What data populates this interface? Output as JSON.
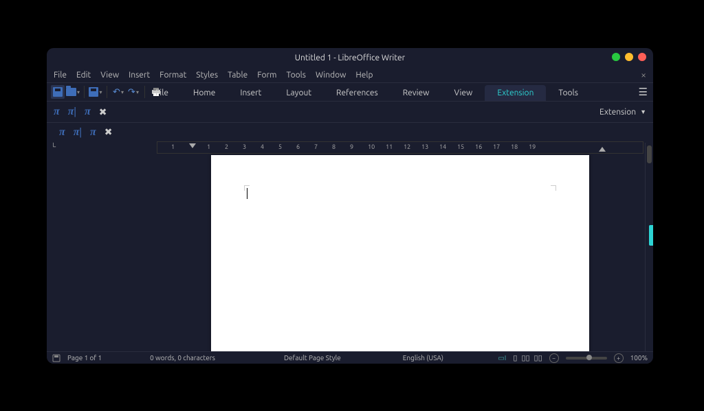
{
  "title": "Untitled 1 - LibreOffice Writer",
  "menus": {
    "file": "File",
    "edit": "Edit",
    "view": "View",
    "insert": "Insert",
    "format": "Format",
    "styles": "Styles",
    "table": "Table",
    "form": "Form",
    "tools": "Tools",
    "window": "Window",
    "help": "Help"
  },
  "tabs": {
    "file": "File",
    "home": "Home",
    "insert": "Insert",
    "layout": "Layout",
    "references": "References",
    "review": "Review",
    "view": "View",
    "extension": "Extension",
    "tools": "Tools"
  },
  "active_tab": "extension",
  "extension_panel": {
    "label": "Extension"
  },
  "ruler": {
    "numbers": [
      "1",
      "1",
      "2",
      "3",
      "4",
      "5",
      "6",
      "7",
      "8",
      "9",
      "10",
      "11",
      "12",
      "13",
      "14",
      "15",
      "16",
      "17",
      "18",
      "19"
    ]
  },
  "status": {
    "page": "Page 1 of 1",
    "words": "0 words, 0 characters",
    "style": "Default Page Style",
    "language": "English (USA)",
    "insert_mode": "",
    "zoom": "100%"
  }
}
